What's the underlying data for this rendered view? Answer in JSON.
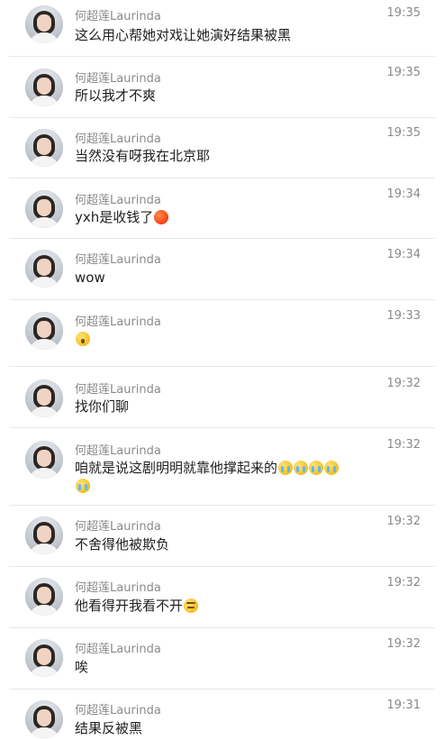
{
  "chat": {
    "messages": [
      {
        "name": "何超莲Laurinda",
        "time": "19:35",
        "text": "这么用心帮她对戏让她演好结果被黑",
        "emojis": []
      },
      {
        "name": "何超莲Laurinda",
        "time": "19:35",
        "text": "所以我才不爽",
        "emojis": []
      },
      {
        "name": "何超莲Laurinda",
        "time": "19:35",
        "text": "当然没有呀我在北京耶",
        "emojis": []
      },
      {
        "name": "何超莲Laurinda",
        "time": "19:34",
        "text": "yxh是收钱了",
        "emojis": [
          "red-angry-emoji"
        ]
      },
      {
        "name": "何超莲Laurinda",
        "time": "19:34",
        "text": "wow",
        "emojis": []
      },
      {
        "name": "何超莲Laurinda",
        "time": "19:33",
        "text": "",
        "emojis": [
          "shocked-emoji"
        ]
      },
      {
        "name": "何超莲Laurinda",
        "time": "19:32",
        "text": "找你们聊",
        "emojis": []
      },
      {
        "name": "何超莲Laurinda",
        "time": "19:32",
        "text": "咱就是说这剧明明就靠他撑起来的",
        "emojis": [
          "crying-emoji",
          "crying-emoji",
          "crying-emoji",
          "crying-emoji",
          "crying-emoji"
        ]
      },
      {
        "name": "何超莲Laurinda",
        "time": "19:32",
        "text": "不舍得他被欺负",
        "emojis": []
      },
      {
        "name": "何超莲Laurinda",
        "time": "19:32",
        "text": "他看得开我看不开",
        "emojis": [
          "smirk-emoji"
        ]
      },
      {
        "name": "何超莲Laurinda",
        "time": "19:32",
        "text": "唉",
        "emojis": []
      },
      {
        "name": "何超莲Laurinda",
        "time": "19:31",
        "text": "结果反被黑",
        "emojis": []
      }
    ]
  }
}
